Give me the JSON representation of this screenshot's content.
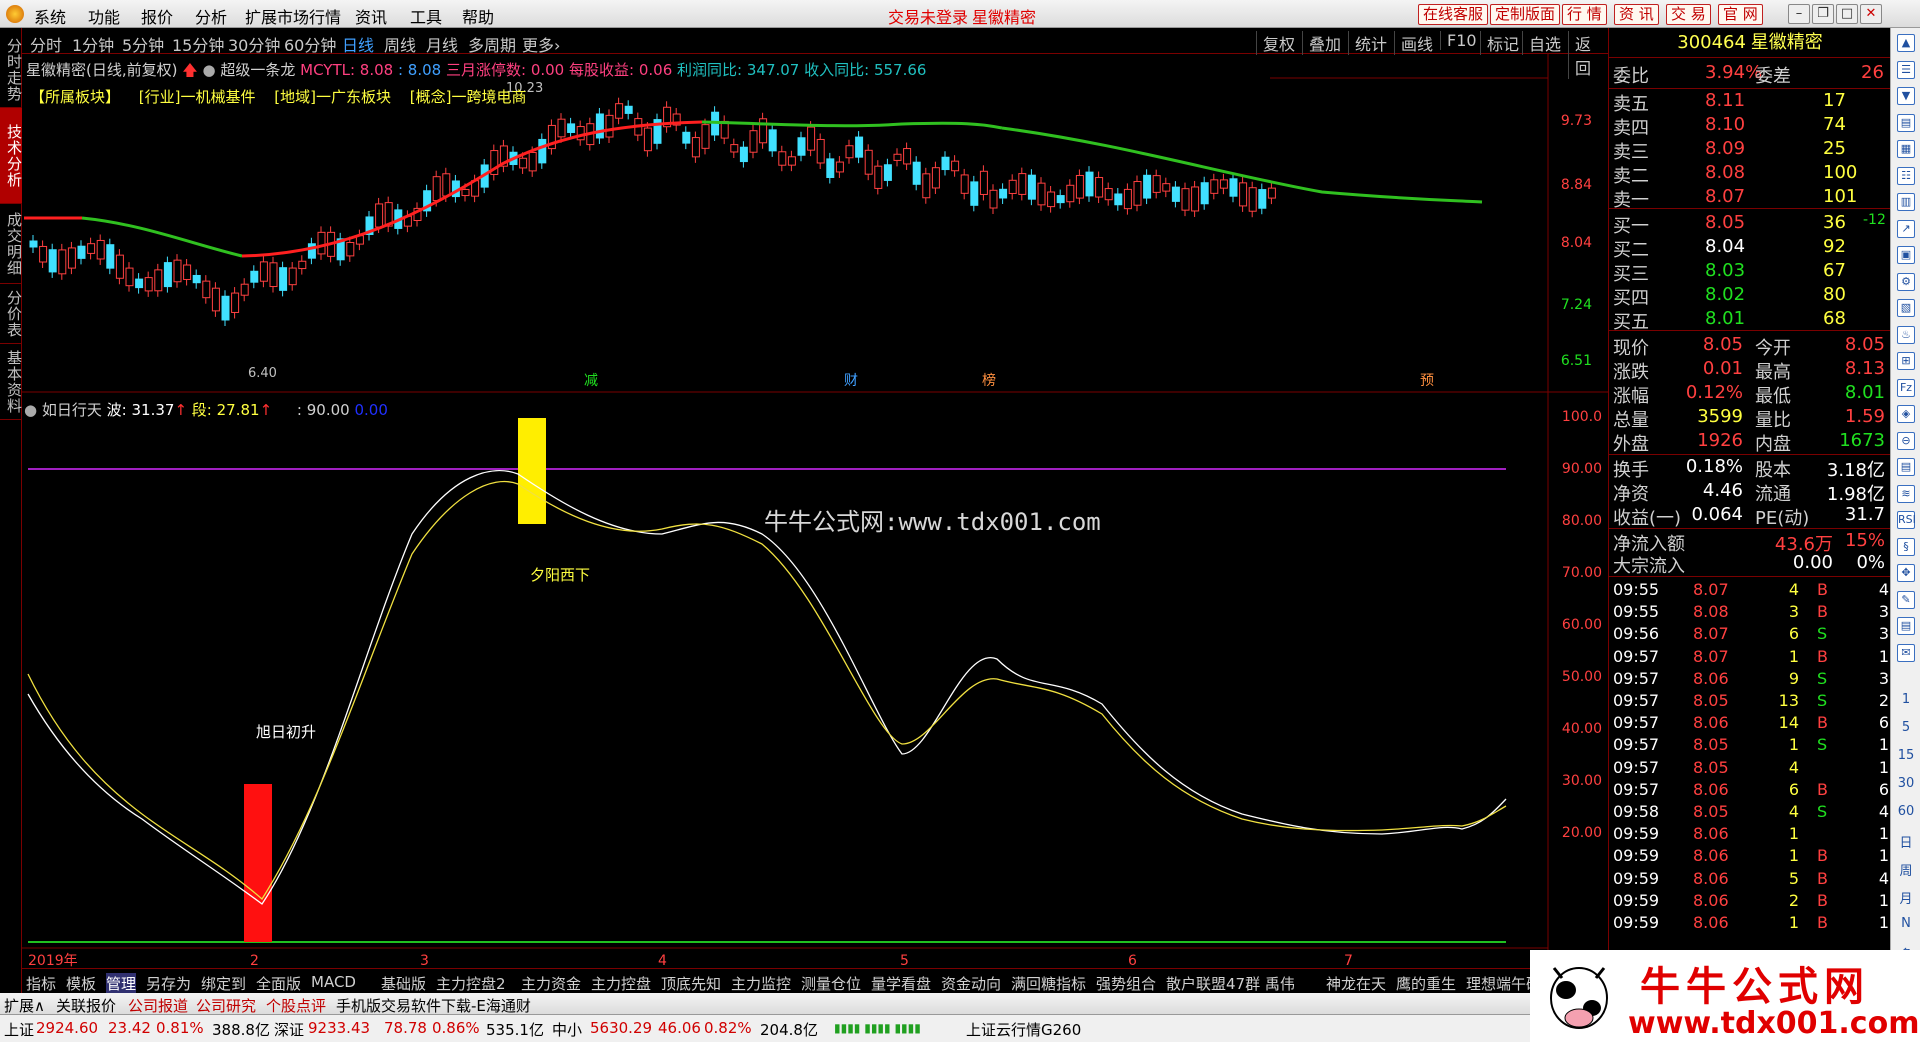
{
  "menubar": {
    "items": [
      "系统",
      "功能",
      "报价",
      "分析",
      "扩展市场行情",
      "资讯",
      "工具",
      "帮助"
    ],
    "login_status": "交易未登录",
    "stock_name": "星徽精密",
    "right_buttons": [
      "在线客服",
      "定制版面",
      "行 情",
      "资 讯",
      "交 易",
      "官 网"
    ]
  },
  "left_tabs": [
    "分时走势",
    "技术分析",
    "成交明细",
    "分价表",
    "基本资料"
  ],
  "period_bar": {
    "periods": [
      "分时",
      "1分钟",
      "5分钟",
      "15分钟",
      "30分钟",
      "60分钟",
      "日线",
      "周线",
      "月线",
      "多周期",
      "更多›"
    ],
    "active": "日线",
    "right_tools": [
      "复权",
      "叠加",
      "统计",
      "画线",
      "F10",
      "标记",
      "自选",
      "返回"
    ]
  },
  "kline_info": {
    "title": "星徽精密(日线,前复权)",
    "indicator": "超级一条龙",
    "mcytl_label": "MCYTL: 8.08",
    "mcytl_val": ": 8.08",
    "zhangting": "三月涨停数: 0.00",
    "meigu": "每股收益: 0.06",
    "lirun": "利润同比: 347.07",
    "shouru": "收入同比: 557.66",
    "bankuai": [
      "【所属板块】",
      "[行业]一机械基件",
      "[地域]一广东板块",
      "[概念]一跨境电商"
    ],
    "high_label": "10.23",
    "low_label": "6.40",
    "event_marks": [
      "减",
      "财",
      "榜",
      "预"
    ]
  },
  "price_axis": [
    "9.73",
    "8.84",
    "8.04",
    "7.24",
    "6.51"
  ],
  "sub_info": {
    "name": "如日行天",
    "bo": "波: 31.37",
    "duan": "段: 27.81",
    "line": ": 90.00",
    "zero": "0.00"
  },
  "sub_axis": [
    "100.0",
    "90.00",
    "80.00",
    "70.00",
    "60.00",
    "50.00",
    "40.00",
    "30.00",
    "20.00"
  ],
  "annotations": {
    "watermark": "牛牛公式网:www.tdx001.com",
    "sunset": "夕阳西下",
    "sunrise": "旭日初升"
  },
  "date_axis": [
    "2019年",
    "2",
    "3",
    "4",
    "5",
    "6",
    "7"
  ],
  "indicator_tabs": [
    "指标",
    "模板",
    "管理",
    "另存为",
    "绑定到",
    "全面版",
    "MACD",
    "基础版",
    "主力控盘2",
    "主力资金",
    "主力控盘",
    "顶底先知",
    "主力监控",
    "测量仓位",
    "量学看盘",
    "资金动向",
    "满回糖指标",
    "强势组合",
    "散户联盟47群 禹伟",
    "神龙在天",
    "鹰的重生",
    "理想端午破解"
  ],
  "quote": {
    "code": "300464",
    "name": "星徽精密",
    "weibi_label": "委比",
    "weibi": "3.94%",
    "weicha_label": "委差",
    "weicha": "26",
    "sells": [
      {
        "label": "卖五",
        "price": "8.11",
        "vol": "17"
      },
      {
        "label": "卖四",
        "price": "8.10",
        "vol": "74"
      },
      {
        "label": "卖三",
        "price": "8.09",
        "vol": "25"
      },
      {
        "label": "卖二",
        "price": "8.08",
        "vol": "100"
      },
      {
        "label": "卖一",
        "price": "8.07",
        "vol": "101"
      }
    ],
    "buys": [
      {
        "label": "买一",
        "price": "8.05",
        "vol": "36",
        "chg": "-12"
      },
      {
        "label": "买二",
        "price": "8.04",
        "vol": "92",
        "chg": ""
      },
      {
        "label": "买三",
        "price": "8.03",
        "vol": "67",
        "chg": ""
      },
      {
        "label": "买四",
        "price": "8.02",
        "vol": "80",
        "chg": ""
      },
      {
        "label": "买五",
        "price": "8.01",
        "vol": "68",
        "chg": ""
      }
    ],
    "stats": [
      {
        "l1": "现价",
        "v1": "8.05",
        "c1": "red",
        "l2": "今开",
        "v2": "8.05",
        "c2": "red"
      },
      {
        "l1": "涨跌",
        "v1": "0.01",
        "c1": "red",
        "l2": "最高",
        "v2": "8.13",
        "c2": "red"
      },
      {
        "l1": "涨幅",
        "v1": "0.12%",
        "c1": "red",
        "l2": "最低",
        "v2": "8.01",
        "c2": "green"
      },
      {
        "l1": "总量",
        "v1": "3599",
        "c1": "yellow",
        "l2": "量比",
        "v2": "1.59",
        "c2": "red"
      },
      {
        "l1": "外盘",
        "v1": "1926",
        "c1": "red",
        "l2": "内盘",
        "v2": "1673",
        "c2": "green"
      }
    ],
    "fund": [
      {
        "l1": "换手",
        "v1": "0.18%",
        "l2": "股本",
        "v2": "3.18亿"
      },
      {
        "l1": "净资",
        "v1": "4.46",
        "l2": "流通",
        "v2": "1.98亿"
      },
      {
        "l1": "收益(一)",
        "v1": "0.064",
        "l2": "PE(动)",
        "v2": "31.7"
      }
    ],
    "flow": [
      {
        "label": "净流入额",
        "value": "43.6万",
        "pct": "15%"
      },
      {
        "label": "大宗流入",
        "value": "0.00",
        "pct": "0%"
      }
    ],
    "ticks": [
      {
        "t": "09:55",
        "p": "8.07",
        "v": "4",
        "d": "B",
        "n": "4"
      },
      {
        "t": "09:55",
        "p": "8.08",
        "v": "3",
        "d": "B",
        "n": "3"
      },
      {
        "t": "09:56",
        "p": "8.07",
        "v": "6",
        "d": "S",
        "n": "3"
      },
      {
        "t": "09:57",
        "p": "8.07",
        "v": "1",
        "d": "B",
        "n": "1"
      },
      {
        "t": "09:57",
        "p": "8.06",
        "v": "9",
        "d": "S",
        "n": "3"
      },
      {
        "t": "09:57",
        "p": "8.05",
        "v": "13",
        "d": "S",
        "n": "2"
      },
      {
        "t": "09:57",
        "p": "8.06",
        "v": "14",
        "d": "B",
        "n": "6"
      },
      {
        "t": "09:57",
        "p": "8.05",
        "v": "1",
        "d": "S",
        "n": "1"
      },
      {
        "t": "09:57",
        "p": "8.05",
        "v": "4",
        "d": "",
        "n": "1"
      },
      {
        "t": "09:57",
        "p": "8.06",
        "v": "6",
        "d": "B",
        "n": "6"
      },
      {
        "t": "09:58",
        "p": "8.05",
        "v": "4",
        "d": "S",
        "n": "4"
      },
      {
        "t": "09:59",
        "p": "8.06",
        "v": "1",
        "d": "",
        "n": "1"
      },
      {
        "t": "09:59",
        "p": "8.06",
        "v": "1",
        "d": "B",
        "n": "1"
      },
      {
        "t": "09:59",
        "p": "8.06",
        "v": "5",
        "d": "B",
        "n": "4"
      },
      {
        "t": "09:59",
        "p": "8.06",
        "v": "2",
        "d": "B",
        "n": "1"
      },
      {
        "t": "09:59",
        "p": "8.06",
        "v": "1",
        "d": "B",
        "n": "1"
      }
    ]
  },
  "right_strip_labels": [
    "1",
    "5",
    "15",
    "30",
    "60",
    "日",
    "周",
    "月",
    "N",
    "多"
  ],
  "status": {
    "tabs": [
      "扩展∧",
      "关联报价",
      "公司报道",
      "公司研究",
      "个股点评",
      "手机版交易软件下载-E海通财"
    ],
    "sh_label": "上证",
    "sh": "2924.60",
    "sh_chg": "23.42",
    "sh_pct": "0.81%",
    "sh_amt": "388.8亿",
    "sz_label": "深证",
    "sz": "9233.43",
    "sz_chg": "78.78",
    "sz_pct": "0.86%",
    "sz_amt": "535.1亿",
    "zx_label": "中小",
    "zx": "5630.29",
    "zx_chg": "46.06",
    "zx_pct": "0.82%",
    "zx_amt": "204.8亿",
    "cloud": "上证云行情G260"
  },
  "brand": {
    "title": "牛牛公式网",
    "url": "www.tdx001.com"
  }
}
